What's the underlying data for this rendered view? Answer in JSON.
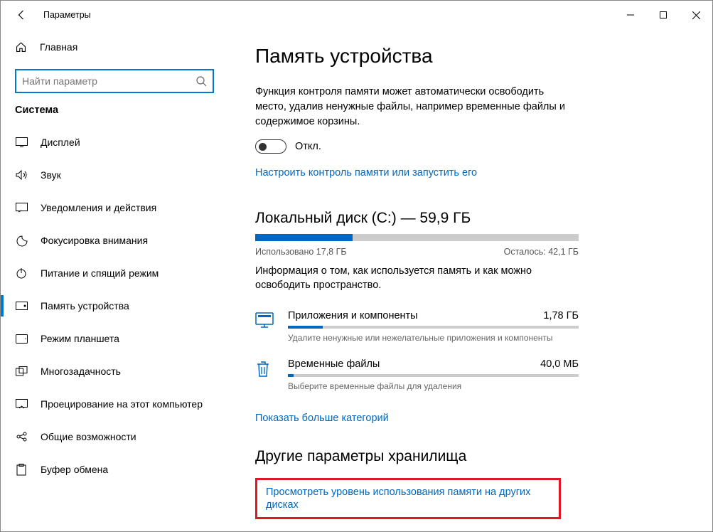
{
  "titlebar": {
    "title": "Параметры"
  },
  "sidebar": {
    "home": "Главная",
    "search_placeholder": "Найти параметр",
    "category": "Система",
    "items": [
      {
        "label": "Дисплей"
      },
      {
        "label": "Звук"
      },
      {
        "label": "Уведомления и действия"
      },
      {
        "label": "Фокусировка внимания"
      },
      {
        "label": "Питание и спящий режим"
      },
      {
        "label": "Память устройства"
      },
      {
        "label": "Режим планшета"
      },
      {
        "label": "Многозадачность"
      },
      {
        "label": "Проецирование на этот компьютер"
      },
      {
        "label": "Общие возможности"
      },
      {
        "label": "Буфер обмена"
      }
    ]
  },
  "main": {
    "title": "Память устройства",
    "description": "Функция контроля памяти может автоматически освободить место, удалив ненужные файлы, например временные файлы и содержимое корзины.",
    "toggle_state": "Откл.",
    "configure_link": "Настроить контроль памяти или запустить его",
    "disk": {
      "heading": "Локальный диск (C:) — 59,9 ГБ",
      "used_label": "Использовано 17,8 ГБ",
      "free_label": "Осталось: 42,1 ГБ",
      "fill_percent": 30,
      "info": "Информация о том, как используется память и как можно освободить пространство."
    },
    "categories": [
      {
        "name": "Приложения и компоненты",
        "size": "1,78 ГБ",
        "sub": "Удалите ненужные или нежелательные приложения и компоненты",
        "fill": 12
      },
      {
        "name": "Временные файлы",
        "size": "40,0 МБ",
        "sub": "Выберите временные файлы для удаления",
        "fill": 2
      }
    ],
    "show_more": "Показать больше категорий",
    "other_heading": "Другие параметры хранилища",
    "other_link": "Просмотреть уровень использования памяти на других дисках"
  }
}
